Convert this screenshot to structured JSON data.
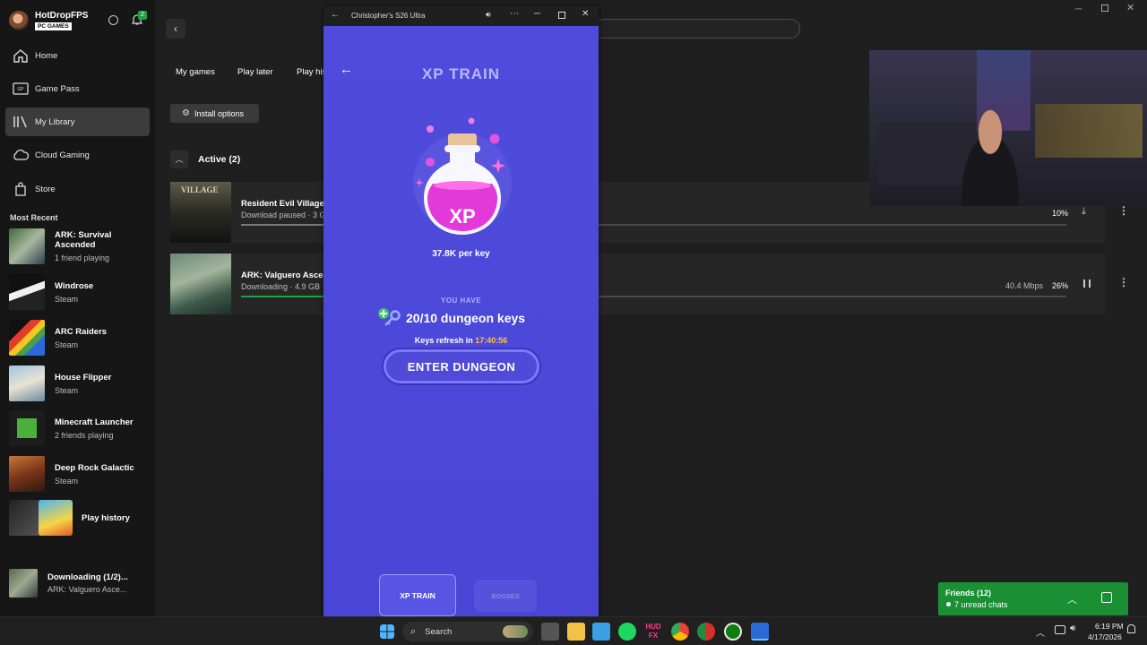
{
  "profile": {
    "name": "HotDropFPS",
    "badge": "PC GAMES",
    "notifications": "2"
  },
  "nav": [
    {
      "label": "Home",
      "icon": "home-icon"
    },
    {
      "label": "Game Pass",
      "icon": "gamepass-icon"
    },
    {
      "label": "My Library",
      "icon": "library-icon"
    },
    {
      "label": "Cloud Gaming",
      "icon": "cloud-icon"
    },
    {
      "label": "Store",
      "icon": "store-icon"
    }
  ],
  "most_recent_label": "Most Recent",
  "recent": [
    {
      "title": "ARK: Survival Ascended",
      "sub": "1 friend playing"
    },
    {
      "title": "Windrose",
      "sub": "Steam"
    },
    {
      "title": "ARC Raiders",
      "sub": "Steam"
    },
    {
      "title": "House Flipper",
      "sub": "Steam"
    },
    {
      "title": "Minecraft Launcher",
      "sub": "2 friends playing"
    },
    {
      "title": "Deep Rock Galactic",
      "sub": "Steam"
    }
  ],
  "play_history": "Play history",
  "downloading": {
    "title": "Downloading (1/2)...",
    "sub": "ARK: Valguero Asce..."
  },
  "main": {
    "tabs": [
      "My games",
      "Play later",
      "Play his"
    ],
    "install_options": "Install options",
    "active_header": "Active (2)",
    "rows": [
      {
        "title": "Resident Evil Village",
        "status": "Download paused · 3 G",
        "speed": "",
        "percent": "10%",
        "progress": 0.1
      },
      {
        "title": "ARK: Valguero Ascen",
        "status": "Downloading · 4.9 GB",
        "speed": "40.4 Mbps",
        "percent": "26%",
        "progress": 0.26
      }
    ]
  },
  "phone": {
    "window_title": "Christopher's S26 Ultra",
    "screen_title": "XP TRAIN",
    "potion_label": "XP",
    "per_key": "37.8K per key",
    "you_have": "YOU HAVE",
    "keys": "20/10 dungeon keys",
    "refresh_prefix": "Keys refresh in",
    "refresh_time": "17:40:56",
    "enter_button": "ENTER DUNGEON",
    "tabs": [
      "XP TRAIN",
      "BOSSES"
    ]
  },
  "friends": {
    "title": "Friends (12)",
    "sub": "7 unread chats"
  },
  "taskbar": {
    "search": "Search",
    "time": "6:19 PM",
    "date": "4/17/2026"
  },
  "colors": {
    "accent_green": "#1fa445",
    "phone_bg": "#4d48d9",
    "gold": "#ffc04d"
  }
}
